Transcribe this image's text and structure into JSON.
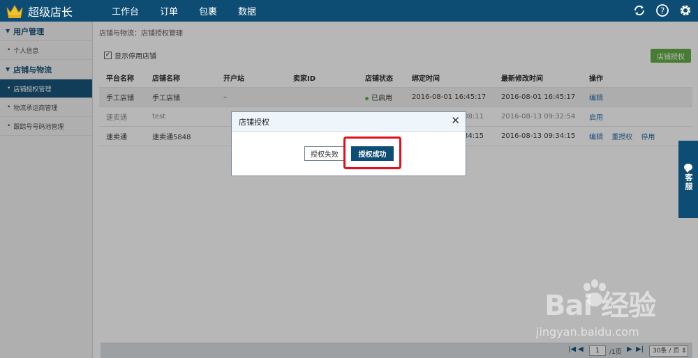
{
  "topbar": {
    "brand": "超级店长",
    "nav": [
      "工作台",
      "订单",
      "包裹",
      "数据"
    ],
    "icons": [
      "refresh-icon",
      "help-icon",
      "settings-icon"
    ]
  },
  "sidebar": {
    "sections": [
      {
        "title": "用户管理",
        "items": [
          {
            "label": "个人信息",
            "active": false
          }
        ]
      },
      {
        "title": "店铺与物流",
        "items": [
          {
            "label": "店铺授权管理",
            "active": true
          },
          {
            "label": "物流承运商管理",
            "active": false
          },
          {
            "label": "跟踪号号码池管理",
            "active": false
          }
        ]
      }
    ]
  },
  "main": {
    "breadcrumb": "店铺与物流：店铺授权管理",
    "show_disabled_label": "显示停用店铺",
    "show_disabled_checked": true,
    "authorize_button": "店铺授权",
    "columns": [
      "平台名称",
      "店铺名称",
      "开户站",
      "卖家ID",
      "店铺状态",
      "绑定时间",
      "最新修改时间",
      "操作"
    ],
    "rows": [
      {
        "platform": "手工店铺",
        "store": "手工店铺",
        "station": "–",
        "seller": "",
        "status": "已启用",
        "bind": "2016-08-01 16:45:17",
        "modified": "2016-08-01 16:45:17",
        "actions": [
          "编辑"
        ]
      },
      {
        "platform": "速卖通",
        "store": "test",
        "station": "",
        "seller": "",
        "status": "",
        "bind": "7:08:11",
        "modified": "2016-08-13 09:32:54",
        "actions": [
          "启用"
        ]
      },
      {
        "platform": "速卖通",
        "store": "速卖通5848",
        "station": "",
        "seller": "",
        "status": "",
        "bind": "09:34:15",
        "modified": "2016-08-13 09:34:15",
        "actions": [
          "编辑",
          "重授权",
          "停用"
        ]
      }
    ]
  },
  "modal": {
    "title": "店铺授权",
    "fail_button": "授权失败",
    "success_button": "授权成功",
    "highlight_color": "#e0101a"
  },
  "customer_service": {
    "label": "客服"
  },
  "watermark": {
    "brand": "Bai 经验",
    "url": "jingyan.baidu.com"
  },
  "pagination": {
    "current_page": "1",
    "total_label": "/1页",
    "page_size": "30条 / 页 ⇕"
  },
  "colors": {
    "brand": "#0d4c73",
    "accent_green": "#5aa83b",
    "link": "#1f66a6"
  }
}
